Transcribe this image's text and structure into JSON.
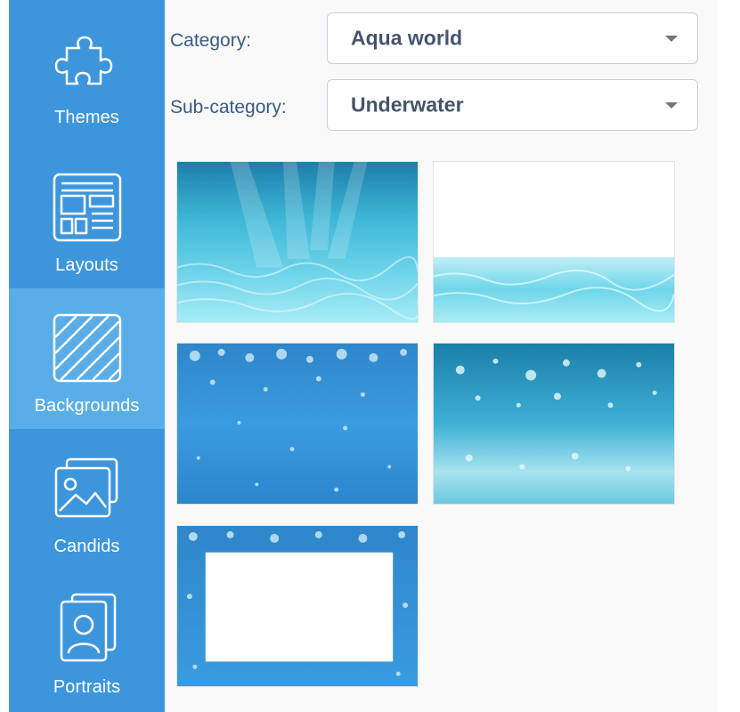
{
  "sidebar": {
    "items": [
      {
        "label": "Themes",
        "icon": "puzzle-piece-icon",
        "active": false
      },
      {
        "label": "Layouts",
        "icon": "layout-grid-icon",
        "active": false
      },
      {
        "label": "Backgrounds",
        "icon": "hatched-square-icon",
        "active": true
      },
      {
        "label": "Candids",
        "icon": "photos-icon",
        "active": false
      },
      {
        "label": "Portraits",
        "icon": "portrait-icon",
        "active": false
      }
    ]
  },
  "filters": {
    "category_label": "Category:",
    "category_value": "Aqua world",
    "subcategory_label": "Sub-category:",
    "subcategory_value": "Underwater"
  },
  "thumbnails": [
    {
      "name": "underwater-light-rays"
    },
    {
      "name": "white-sky-water-strip"
    },
    {
      "name": "blue-bubbles"
    },
    {
      "name": "teal-bubbles"
    },
    {
      "name": "bubble-frame-white-center"
    }
  ],
  "colors": {
    "sidebar": "#3d96dc",
    "sidebar_active": "#5aaee8",
    "label_text": "#3b5a82",
    "select_text": "#44556b"
  }
}
